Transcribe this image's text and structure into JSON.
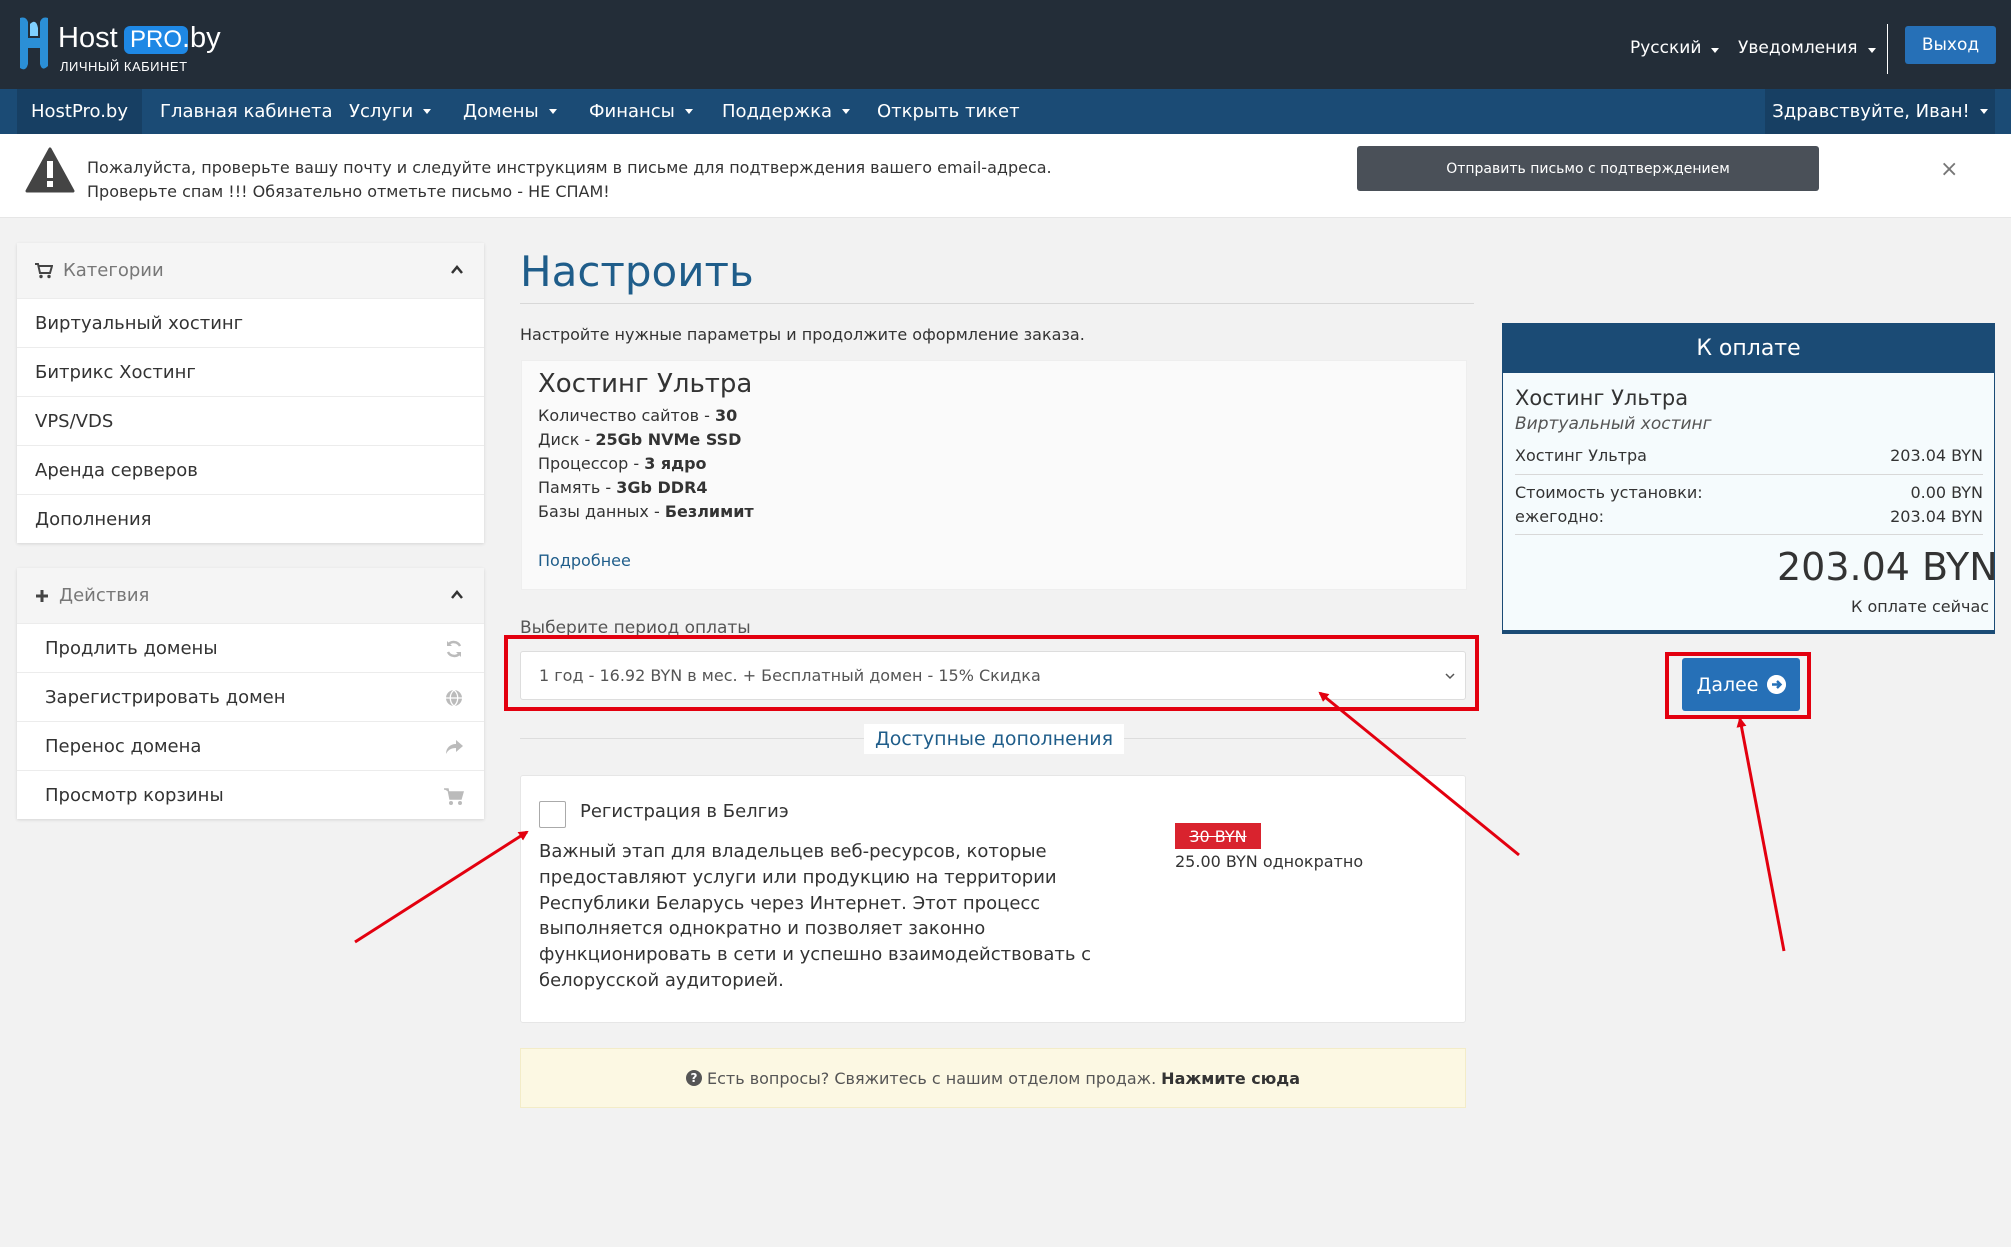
{
  "header": {
    "logo_host": "Host",
    "logo_pro": "PRO",
    "logo_by": ".by",
    "logo_subtitle": "ЛИЧНЫЙ КАБИНЕТ",
    "language": "Русский",
    "notifications": "Уведомления",
    "logout": "Выход"
  },
  "nav": {
    "brand": "HostPro.by",
    "items": [
      {
        "label": "Главная кабинета"
      },
      {
        "label": "Услуги"
      },
      {
        "label": "Домены"
      },
      {
        "label": "Финансы"
      },
      {
        "label": "Поддержка"
      },
      {
        "label": "Открыть тикет"
      }
    ],
    "greeting": "Здравствуйте, Иван!"
  },
  "alert": {
    "line1": "Пожалуйста, проверьте вашу почту и следуйте инструкциям в письме для подтверждения вашего email-адреса.",
    "line2": "Проверьте спам !!! Обязательно отметьте письмо - НЕ СПАМ!",
    "button": "Отправить письмо с подтверждением",
    "close": "×"
  },
  "sidebar": {
    "categories": {
      "title": "Категории",
      "items": [
        {
          "label": "Виртуальный хостинг"
        },
        {
          "label": "Битрикс Хостинг"
        },
        {
          "label": "VPS/VDS"
        },
        {
          "label": "Аренда серверов"
        },
        {
          "label": "Дополнения"
        }
      ]
    },
    "actions": {
      "title": "Действия",
      "items": [
        {
          "label": "Продлить домены",
          "icon": "refresh-icon"
        },
        {
          "label": "Зарегистрировать домен",
          "icon": "globe-icon"
        },
        {
          "label": "Перенос домена",
          "icon": "share-arrow-icon"
        },
        {
          "label": "Просмотр корзины",
          "icon": "cart-icon"
        }
      ]
    }
  },
  "main": {
    "title": "Настроить",
    "subtitle": "Настройте нужные параметры и продолжите оформление заказа.",
    "product": {
      "name": "Хостинг Ультра",
      "specs": [
        {
          "label": "Количество сайтов - ",
          "value": "30"
        },
        {
          "label": "Диск - ",
          "value": "25Gb NVMe SSD"
        },
        {
          "label": "Процессор - ",
          "value": "3 ядро"
        },
        {
          "label": "Память - ",
          "value": "3Gb DDR4"
        },
        {
          "label": "Базы данных - ",
          "value": "Безлимит"
        }
      ],
      "more": "Подробнее"
    },
    "period_label": "Выберите период оплаты",
    "period_selected": "1 год - 16.92 BYN в мес. + Бесплатный домен - 15% Скидка",
    "addons_title": "Доступные дополнения",
    "addon": {
      "name": "Регистрация в Белгиэ",
      "description": [
        "Важный этап для владельцев веб-ресурсов, которые",
        "предоставляют услуги или продукцию на территории",
        "Республики Беларусь через Интернет. Этот процесс",
        "выполняется однократно и позволяет законно",
        "функционировать в сети и успешно взаимодействовать с",
        "белорусской аудиторией."
      ],
      "old_price": "30 BYN",
      "new_price": "25.00 BYN однократно"
    },
    "help_text": "Есть вопросы? Свяжитесь с нашим отделом продаж.",
    "help_link": "Нажмите сюда"
  },
  "summary": {
    "title": "К оплате",
    "product_name": "Хостинг Ультра",
    "category": "Виртуальный хостинг",
    "line_label": "Хостинг Ультра",
    "line_value": "203.04 BYN",
    "setup_label": "Стоимость установки:",
    "setup_value": "0.00 BYN",
    "yearly_label": "ежегодно:",
    "yearly_value": "203.04 BYN",
    "total": "203.04 BYN",
    "total_label": "К оплате сейчас",
    "next_button": "Далее"
  },
  "colors": {
    "header_bg": "#232d38",
    "nav_bg": "#1b4b75",
    "accent": "#2670b7",
    "annotation": "#e3000f",
    "price_badge": "#d9232e"
  }
}
